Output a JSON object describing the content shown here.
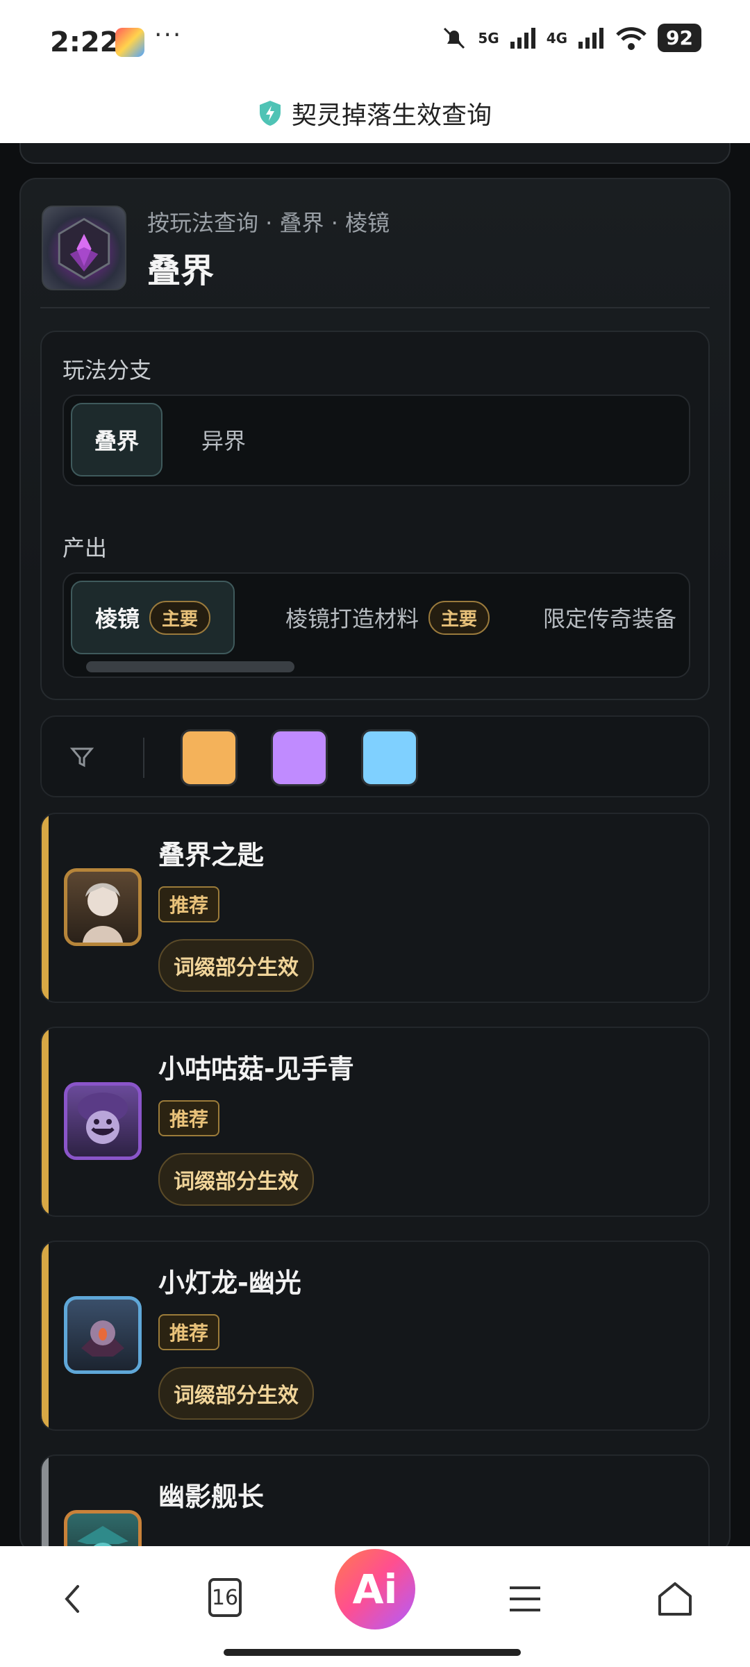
{
  "status_bar": {
    "time": "2:22",
    "more": "···",
    "net1": "5G",
    "net2": "4G",
    "battery": "92"
  },
  "title_bar": {
    "title": "契灵掉落生效查询"
  },
  "header": {
    "breadcrumb": "按玩法查询 · 叠界 · 棱镜",
    "title": "叠界"
  },
  "filters": {
    "branch_label": "玩法分支",
    "branches": [
      "叠界",
      "异界"
    ],
    "output_label": "产出",
    "outputs": [
      {
        "label": "棱镜",
        "tag": "主要"
      },
      {
        "label": "棱镜打造材料",
        "tag": "主要"
      },
      {
        "label": "限定传奇装备"
      }
    ]
  },
  "colors": {
    "swatches": [
      "#f4b25a",
      "#c08bff",
      "#7fd0ff"
    ],
    "accent_gold": "#d8a845"
  },
  "items": [
    {
      "name": "叠界之匙",
      "badge": "推荐",
      "effect": "词缀部分生效",
      "frame": "#b6853a"
    },
    {
      "name": "小咕咕菇-见手青",
      "badge": "推荐",
      "effect": "词缀部分生效",
      "frame": "#8a55c9"
    },
    {
      "name": "小灯龙-幽光",
      "badge": "推荐",
      "effect": "词缀部分生效",
      "frame": "#5fa7d8"
    },
    {
      "name": "幽影舰长",
      "frame": "#c9823a"
    }
  ],
  "nav": {
    "tabs_count": "16",
    "ai_label": "Ai"
  }
}
